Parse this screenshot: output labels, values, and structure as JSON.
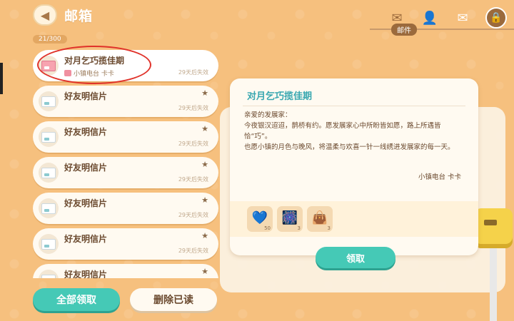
{
  "header": {
    "back_icon": "chevron-left-icon",
    "title": "邮箱",
    "tabs": [
      {
        "icon": "envelope-icon",
        "label": "邮件",
        "active": true
      },
      {
        "icon": "add-friend-icon",
        "active": false
      },
      {
        "icon": "envelope-check-icon",
        "active": false
      }
    ],
    "profile_icon": "profile-lock-icon"
  },
  "mail_count": "21/300",
  "mails": [
    {
      "title": "对月乞巧揽佳期",
      "sender": "小镇电台 卡卡",
      "expiry": "29天后失效",
      "starred": false,
      "thumb": "pink",
      "selected": true
    },
    {
      "title": "好友明信片",
      "sender": "",
      "expiry": "29天后失效",
      "starred": true,
      "thumb": "card",
      "selected": false
    },
    {
      "title": "好友明信片",
      "sender": "",
      "expiry": "29天后失效",
      "starred": true,
      "thumb": "card",
      "selected": false
    },
    {
      "title": "好友明信片",
      "sender": "",
      "expiry": "29天后失效",
      "starred": true,
      "thumb": "card",
      "selected": false
    },
    {
      "title": "好友明信片",
      "sender": "",
      "expiry": "29天后失效",
      "starred": true,
      "thumb": "card",
      "selected": false
    },
    {
      "title": "好友明信片",
      "sender": "",
      "expiry": "29天后失效",
      "starred": true,
      "thumb": "card",
      "selected": false
    },
    {
      "title": "好友明信片",
      "sender": "",
      "expiry": "",
      "starred": true,
      "thumb": "card",
      "selected": false
    }
  ],
  "buttons": {
    "claim_all": "全部领取",
    "delete_read": "删除已读",
    "claim": "领取"
  },
  "detail": {
    "title": "对月乞巧揽佳期",
    "greeting": "亲爱的发展家：",
    "body": [
      "今夜银汉迢迢，鹊桥有约。愿发展家心中所盼皆如愿，路上所遇皆恰“巧”。",
      "也愿小镇的月色与晚风，将温柔与欢喜一针一线绣进发展家的每一天。"
    ],
    "signature": "小镇电台 卡卡",
    "rewards": [
      {
        "icon": "blue-heart-gem-icon",
        "glyph": "💙",
        "qty": "50"
      },
      {
        "icon": "firework-tube-icon",
        "glyph": "🎆",
        "qty": "3"
      },
      {
        "icon": "lucky-bag-icon",
        "glyph": "👜",
        "qty": "3"
      }
    ]
  },
  "colors": {
    "background": "#f6c07e",
    "accent_teal": "#45c9b6",
    "title_teal": "#37a7b0",
    "brown_text": "#6b4a2f",
    "highlight_red": "#e0322a"
  }
}
